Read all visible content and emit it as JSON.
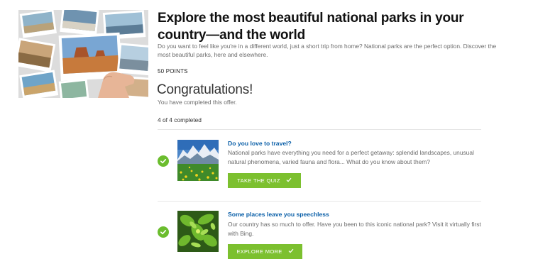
{
  "offer": {
    "title": "Explore the most beautiful national parks in your country—and the world",
    "description": "Do you want to feel like you're in a different world, just a short trip from home? National parks are the perfect option. Discover the most beautiful parks, here and elsewhere.",
    "points": "50 POINTS",
    "status_heading": "Congratulations!",
    "status_message": "You have completed this offer.",
    "progress": "4 of 4 completed"
  },
  "tasks": [
    {
      "title": "Do you love to travel?",
      "description": "National parks have everything you need for a perfect getaway: splendid landscapes, unusual natural phenomena, varied fauna and flora... What do you know about them?",
      "button_label": "TAKE THE QUIZ",
      "completed": true,
      "thumbnail": "mountain-meadow"
    },
    {
      "title": "Some places leave you speechless",
      "description": "Our country has so much to offer. Have you been to this iconic national park? Visit it virtually first with Bing.",
      "button_label": "EXPLORE MORE",
      "completed": true,
      "thumbnail": "green-foliage"
    }
  ],
  "colors": {
    "accent_green": "#7cc02f",
    "check_green": "#6bbd2e",
    "link_blue": "#0a5fa8"
  },
  "icons": [
    "check-circle-icon",
    "checkmark-icon"
  ]
}
